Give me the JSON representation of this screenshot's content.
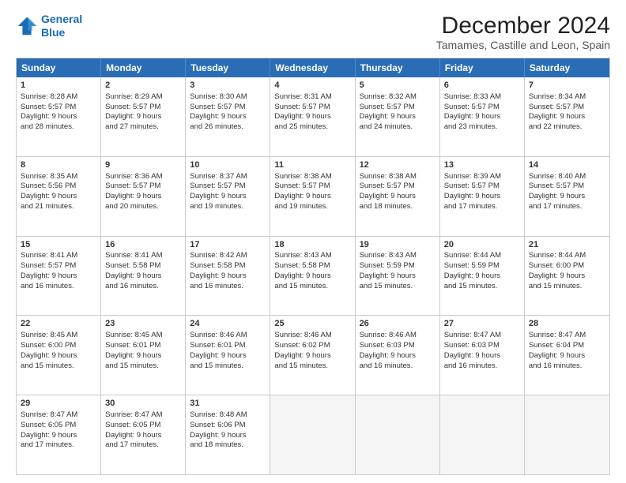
{
  "logo": {
    "line1": "General",
    "line2": "Blue"
  },
  "title": "December 2024",
  "subtitle": "Tamames, Castille and Leon, Spain",
  "header_days": [
    "Sunday",
    "Monday",
    "Tuesday",
    "Wednesday",
    "Thursday",
    "Friday",
    "Saturday"
  ],
  "weeks": [
    [
      {
        "day": "1",
        "lines": [
          "Sunrise: 8:28 AM",
          "Sunset: 5:57 PM",
          "Daylight: 9 hours",
          "and 28 minutes."
        ]
      },
      {
        "day": "2",
        "lines": [
          "Sunrise: 8:29 AM",
          "Sunset: 5:57 PM",
          "Daylight: 9 hours",
          "and 27 minutes."
        ]
      },
      {
        "day": "3",
        "lines": [
          "Sunrise: 8:30 AM",
          "Sunset: 5:57 PM",
          "Daylight: 9 hours",
          "and 26 minutes."
        ]
      },
      {
        "day": "4",
        "lines": [
          "Sunrise: 8:31 AM",
          "Sunset: 5:57 PM",
          "Daylight: 9 hours",
          "and 25 minutes."
        ]
      },
      {
        "day": "5",
        "lines": [
          "Sunrise: 8:32 AM",
          "Sunset: 5:57 PM",
          "Daylight: 9 hours",
          "and 24 minutes."
        ]
      },
      {
        "day": "6",
        "lines": [
          "Sunrise: 8:33 AM",
          "Sunset: 5:57 PM",
          "Daylight: 9 hours",
          "and 23 minutes."
        ]
      },
      {
        "day": "7",
        "lines": [
          "Sunrise: 8:34 AM",
          "Sunset: 5:57 PM",
          "Daylight: 9 hours",
          "and 22 minutes."
        ]
      }
    ],
    [
      {
        "day": "8",
        "lines": [
          "Sunrise: 8:35 AM",
          "Sunset: 5:56 PM",
          "Daylight: 9 hours",
          "and 21 minutes."
        ]
      },
      {
        "day": "9",
        "lines": [
          "Sunrise: 8:36 AM",
          "Sunset: 5:57 PM",
          "Daylight: 9 hours",
          "and 20 minutes."
        ]
      },
      {
        "day": "10",
        "lines": [
          "Sunrise: 8:37 AM",
          "Sunset: 5:57 PM",
          "Daylight: 9 hours",
          "and 19 minutes."
        ]
      },
      {
        "day": "11",
        "lines": [
          "Sunrise: 8:38 AM",
          "Sunset: 5:57 PM",
          "Daylight: 9 hours",
          "and 19 minutes."
        ]
      },
      {
        "day": "12",
        "lines": [
          "Sunrise: 8:38 AM",
          "Sunset: 5:57 PM",
          "Daylight: 9 hours",
          "and 18 minutes."
        ]
      },
      {
        "day": "13",
        "lines": [
          "Sunrise: 8:39 AM",
          "Sunset: 5:57 PM",
          "Daylight: 9 hours",
          "and 17 minutes."
        ]
      },
      {
        "day": "14",
        "lines": [
          "Sunrise: 8:40 AM",
          "Sunset: 5:57 PM",
          "Daylight: 9 hours",
          "and 17 minutes."
        ]
      }
    ],
    [
      {
        "day": "15",
        "lines": [
          "Sunrise: 8:41 AM",
          "Sunset: 5:57 PM",
          "Daylight: 9 hours",
          "and 16 minutes."
        ]
      },
      {
        "day": "16",
        "lines": [
          "Sunrise: 8:41 AM",
          "Sunset: 5:58 PM",
          "Daylight: 9 hours",
          "and 16 minutes."
        ]
      },
      {
        "day": "17",
        "lines": [
          "Sunrise: 8:42 AM",
          "Sunset: 5:58 PM",
          "Daylight: 9 hours",
          "and 16 minutes."
        ]
      },
      {
        "day": "18",
        "lines": [
          "Sunrise: 8:43 AM",
          "Sunset: 5:58 PM",
          "Daylight: 9 hours",
          "and 15 minutes."
        ]
      },
      {
        "day": "19",
        "lines": [
          "Sunrise: 8:43 AM",
          "Sunset: 5:59 PM",
          "Daylight: 9 hours",
          "and 15 minutes."
        ]
      },
      {
        "day": "20",
        "lines": [
          "Sunrise: 8:44 AM",
          "Sunset: 5:59 PM",
          "Daylight: 9 hours",
          "and 15 minutes."
        ]
      },
      {
        "day": "21",
        "lines": [
          "Sunrise: 8:44 AM",
          "Sunset: 6:00 PM",
          "Daylight: 9 hours",
          "and 15 minutes."
        ]
      }
    ],
    [
      {
        "day": "22",
        "lines": [
          "Sunrise: 8:45 AM",
          "Sunset: 6:00 PM",
          "Daylight: 9 hours",
          "and 15 minutes."
        ]
      },
      {
        "day": "23",
        "lines": [
          "Sunrise: 8:45 AM",
          "Sunset: 6:01 PM",
          "Daylight: 9 hours",
          "and 15 minutes."
        ]
      },
      {
        "day": "24",
        "lines": [
          "Sunrise: 8:46 AM",
          "Sunset: 6:01 PM",
          "Daylight: 9 hours",
          "and 15 minutes."
        ]
      },
      {
        "day": "25",
        "lines": [
          "Sunrise: 8:46 AM",
          "Sunset: 6:02 PM",
          "Daylight: 9 hours",
          "and 15 minutes."
        ]
      },
      {
        "day": "26",
        "lines": [
          "Sunrise: 8:46 AM",
          "Sunset: 6:03 PM",
          "Daylight: 9 hours",
          "and 16 minutes."
        ]
      },
      {
        "day": "27",
        "lines": [
          "Sunrise: 8:47 AM",
          "Sunset: 6:03 PM",
          "Daylight: 9 hours",
          "and 16 minutes."
        ]
      },
      {
        "day": "28",
        "lines": [
          "Sunrise: 8:47 AM",
          "Sunset: 6:04 PM",
          "Daylight: 9 hours",
          "and 16 minutes."
        ]
      }
    ],
    [
      {
        "day": "29",
        "lines": [
          "Sunrise: 8:47 AM",
          "Sunset: 6:05 PM",
          "Daylight: 9 hours",
          "and 17 minutes."
        ]
      },
      {
        "day": "30",
        "lines": [
          "Sunrise: 8:47 AM",
          "Sunset: 6:05 PM",
          "Daylight: 9 hours",
          "and 17 minutes."
        ]
      },
      {
        "day": "31",
        "lines": [
          "Sunrise: 8:48 AM",
          "Sunset: 6:06 PM",
          "Daylight: 9 hours",
          "and 18 minutes."
        ]
      },
      {
        "day": "",
        "lines": []
      },
      {
        "day": "",
        "lines": []
      },
      {
        "day": "",
        "lines": []
      },
      {
        "day": "",
        "lines": []
      }
    ]
  ]
}
